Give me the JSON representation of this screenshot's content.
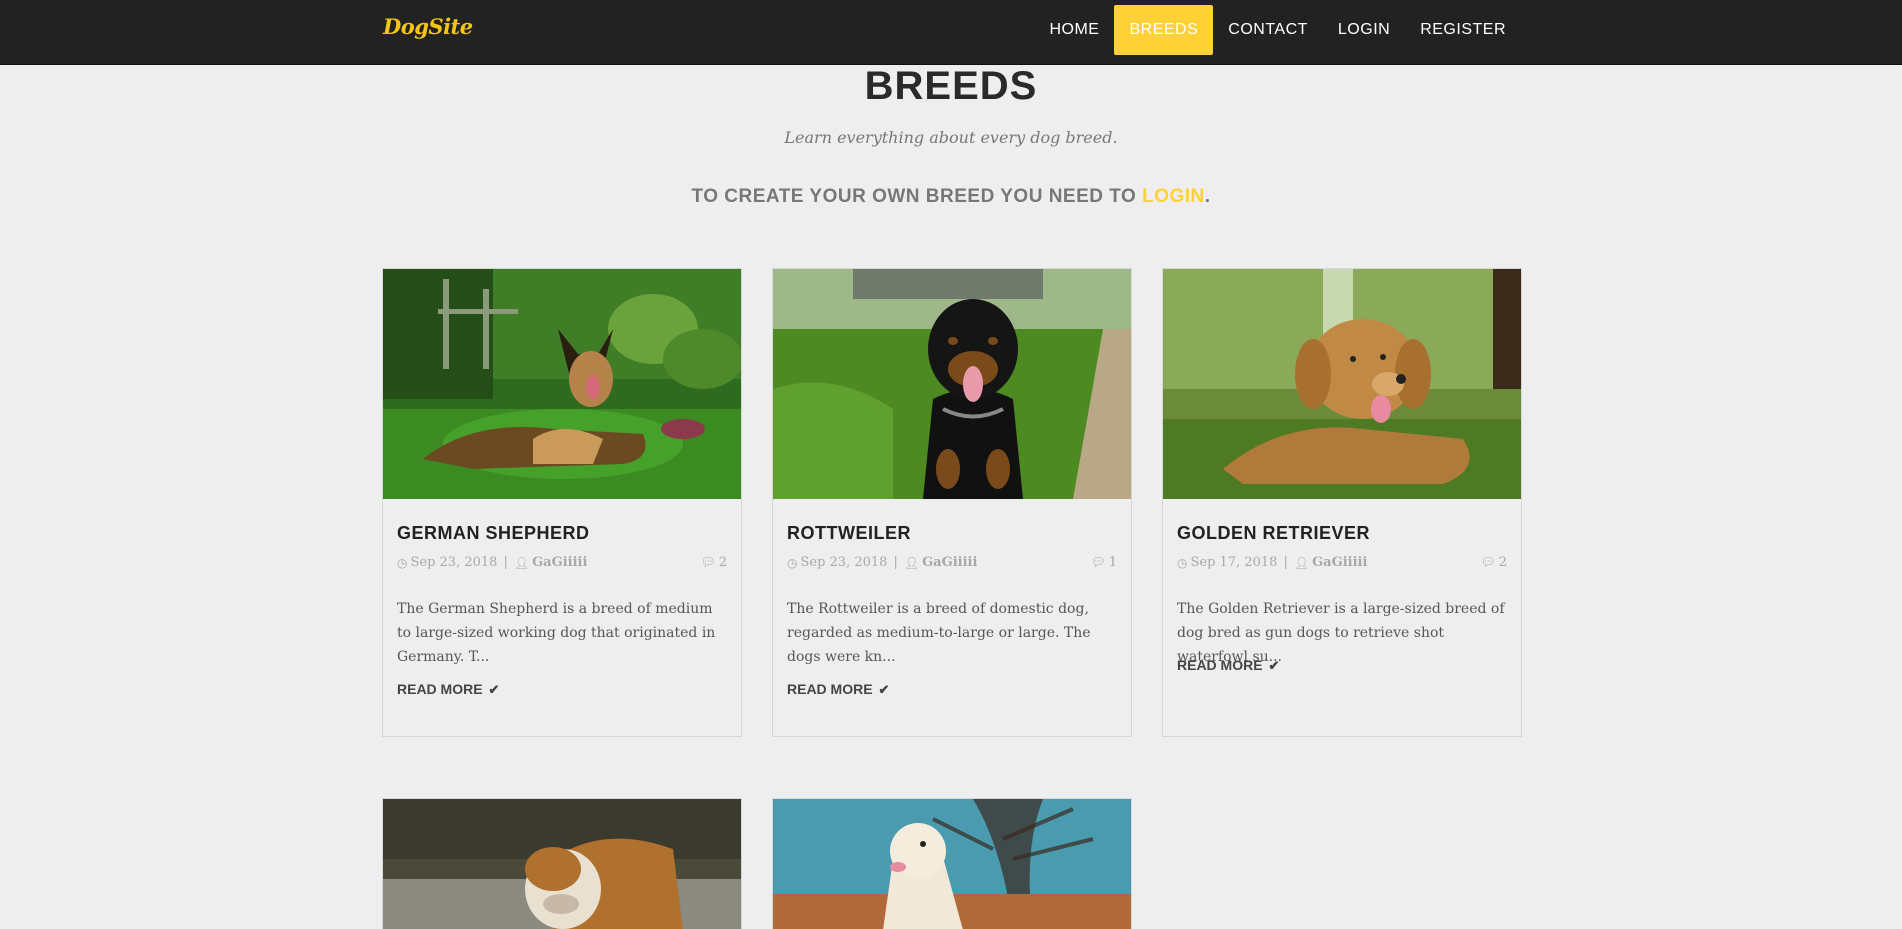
{
  "brand": "DogSite",
  "nav": [
    "HOME",
    "BREEDS",
    "CONTACT",
    "LOGIN",
    "REGISTER"
  ],
  "active_nav": "BREEDS",
  "header": {
    "title": "BREEDS",
    "subtitle": "Learn everything about every dog breed.",
    "login_prefix": "TO CREATE YOUR OWN BREED YOU NEED TO ",
    "login_link": "LOGIN",
    "login_suffix": "."
  },
  "cards": [
    {
      "title": "GERMAN SHEPHERD",
      "date": "Sep 23, 2018",
      "author": "GaGiiiii",
      "comments": "2",
      "excerpt": "The German Shepherd is a breed of medium to large-sized working dog that originated in Germany. T...",
      "read_more": "READ MORE"
    },
    {
      "title": "ROTTWEILER",
      "date": "Sep 23, 2018",
      "author": "GaGiiiii",
      "comments": "1",
      "excerpt": "The Rottweiler is a breed of domestic dog, regarded as medium-to-large or large. The dogs were kn...",
      "read_more": "READ MORE"
    },
    {
      "title": "GOLDEN RETRIEVER",
      "date": "Sep 17, 2018",
      "author": "GaGiiiii",
      "comments": "2",
      "excerpt": "The Golden Retriever is a large-sized breed of dog bred as gun dogs to retrieve shot waterfowl su...",
      "read_more": "READ MORE"
    }
  ],
  "icons": {
    "date": "clock-icon",
    "author": "user-icon",
    "comments": "comment-icon",
    "read_more": "check-icon"
  },
  "colors": {
    "navbar": "#222222",
    "accent": "#fed136",
    "background": "#eeeeee"
  }
}
